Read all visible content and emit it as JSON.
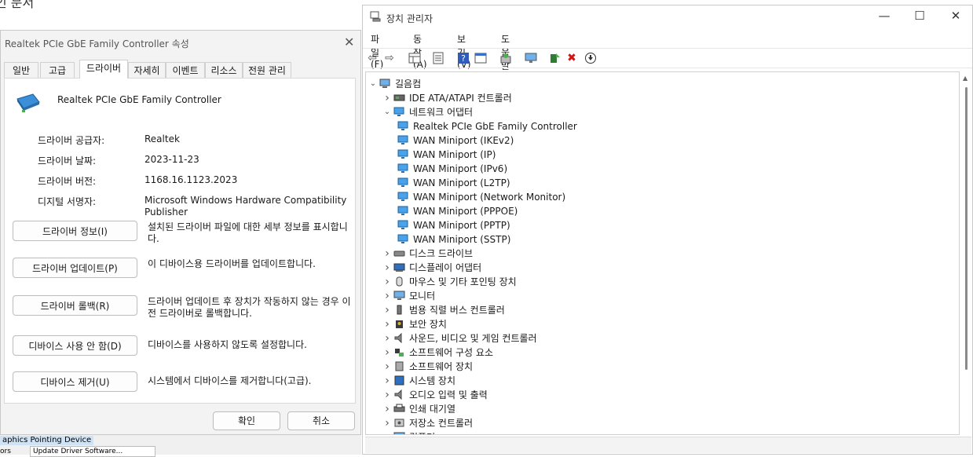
{
  "background": {
    "doc_title": "인 문서",
    "bottom_item1": "aphics Pointing Device",
    "bottom_item2": "ors",
    "bottom_item3": "Update Driver Software..."
  },
  "dialog": {
    "title": "Realtek PCIe GbE Family Controller 속성",
    "tabs": [
      "일반",
      "고급",
      "드라이버",
      "자세히",
      "이벤트",
      "리소스",
      "전원 관리"
    ],
    "active_tab": "드라이버",
    "device_name": "Realtek PCIe GbE Family Controller",
    "fields": [
      {
        "label": "드라이버 공급자:",
        "value": "Realtek"
      },
      {
        "label": "드라이버 날짜:",
        "value": "2023-11-23"
      },
      {
        "label": "드라이버 버전:",
        "value": "1168.16.1123.2023"
      },
      {
        "label": "디지털 서명자:",
        "value": "Microsoft Windows Hardware Compatibility Publisher"
      }
    ],
    "actions": [
      {
        "button": "드라이버 정보(I)",
        "desc": "설치된 드라이버 파일에 대한 세부 정보를 표시합니다."
      },
      {
        "button": "드라이버 업데이트(P)",
        "desc": "이 디바이스용 드라이버를 업데이트합니다."
      },
      {
        "button": "드라이버 롤백(R)",
        "desc": "드라이버 업데이트 후 장치가 작동하지 않는 경우 이전 드라이버로 롤백합니다."
      },
      {
        "button": "디바이스 사용 안 함(D)",
        "desc": "디바이스를 사용하지 않도록 설정합니다."
      },
      {
        "button": "디바이스 제거(U)",
        "desc": "시스템에서 디바이스를 제거합니다(고급)."
      }
    ],
    "ok": "확인",
    "cancel": "취소"
  },
  "devmgr": {
    "title": "장치 관리자",
    "menus": [
      "파일(F)",
      "동작(A)",
      "보기(V)",
      "도움말(H)"
    ],
    "toolbar_icons": [
      "back-icon",
      "forward-icon",
      "properties-grid-icon",
      "list-icon",
      "help-icon",
      "view-icon",
      "scan-hardware-icon",
      "monitor-icon",
      "update-driver-icon",
      "uninstall-icon",
      "download-icon"
    ],
    "root": "길음컴",
    "tree": [
      {
        "label": "IDE ATA/ATAPI 컨트롤러",
        "expanded": false,
        "level": 1,
        "icon": "ide-icon"
      },
      {
        "label": "네트워크 어댑터",
        "expanded": true,
        "level": 1,
        "icon": "network-icon"
      },
      {
        "label": "Realtek PCIe GbE Family Controller",
        "level": 2,
        "icon": "network-icon"
      },
      {
        "label": "WAN Miniport (IKEv2)",
        "level": 2,
        "icon": "network-icon"
      },
      {
        "label": "WAN Miniport (IP)",
        "level": 2,
        "icon": "network-icon"
      },
      {
        "label": "WAN Miniport (IPv6)",
        "level": 2,
        "icon": "network-icon"
      },
      {
        "label": "WAN Miniport (L2TP)",
        "level": 2,
        "icon": "network-icon"
      },
      {
        "label": "WAN Miniport (Network Monitor)",
        "level": 2,
        "icon": "network-icon"
      },
      {
        "label": "WAN Miniport (PPPOE)",
        "level": 2,
        "icon": "network-icon"
      },
      {
        "label": "WAN Miniport (PPTP)",
        "level": 2,
        "icon": "network-icon"
      },
      {
        "label": "WAN Miniport (SSTP)",
        "level": 2,
        "icon": "network-icon"
      },
      {
        "label": "디스크 드라이브",
        "expanded": false,
        "level": 1,
        "icon": "disk-icon"
      },
      {
        "label": "디스플레이 어댑터",
        "expanded": false,
        "level": 1,
        "icon": "display-icon"
      },
      {
        "label": "마우스 및 기타 포인팅 장치",
        "expanded": false,
        "level": 1,
        "icon": "mouse-icon"
      },
      {
        "label": "모니터",
        "expanded": false,
        "level": 1,
        "icon": "monitor-icon"
      },
      {
        "label": "범용 직렬 버스 컨트롤러",
        "expanded": false,
        "level": 1,
        "icon": "usb-icon"
      },
      {
        "label": "보안 장치",
        "expanded": false,
        "level": 1,
        "icon": "security-icon"
      },
      {
        "label": "사운드, 비디오 및 게임 컨트롤러",
        "expanded": false,
        "level": 1,
        "icon": "sound-icon"
      },
      {
        "label": "소프트웨어 구성 요소",
        "expanded": false,
        "level": 1,
        "icon": "software-component-icon"
      },
      {
        "label": "소프트웨어 장치",
        "expanded": false,
        "level": 1,
        "icon": "software-device-icon"
      },
      {
        "label": "시스템 장치",
        "expanded": false,
        "level": 1,
        "icon": "system-icon"
      },
      {
        "label": "오디오 입력 및 출력",
        "expanded": false,
        "level": 1,
        "icon": "audio-icon"
      },
      {
        "label": "인쇄 대기열",
        "expanded": false,
        "level": 1,
        "icon": "printer-icon"
      },
      {
        "label": "저장소 컨트롤러",
        "expanded": false,
        "level": 1,
        "icon": "storage-icon"
      },
      {
        "label": "컴퓨터",
        "expanded": false,
        "level": 1,
        "icon": "computer-icon"
      }
    ]
  }
}
